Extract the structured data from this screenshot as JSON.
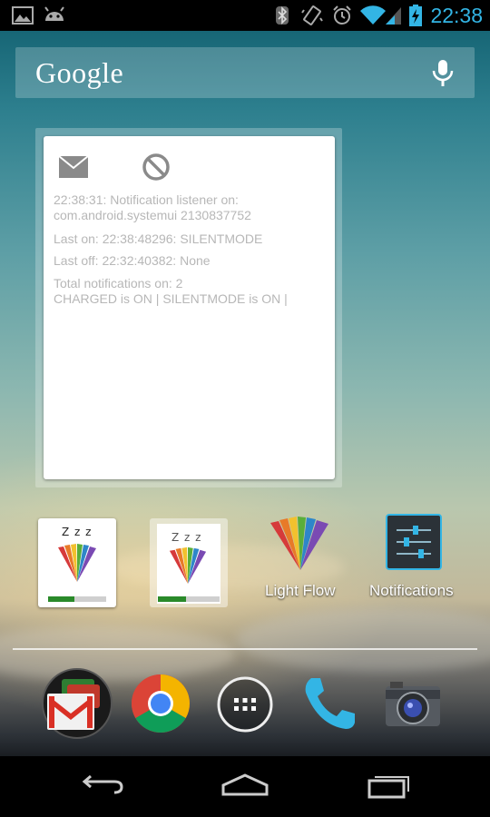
{
  "status_bar": {
    "time": "22:38",
    "left_icons": [
      "gallery-notification-icon",
      "android-debug-icon"
    ],
    "right_icons": [
      "bluetooth-icon",
      "vibrate-icon",
      "alarm-icon",
      "wifi-icon",
      "signal-icon",
      "battery-charging-icon"
    ],
    "accent_color": "#33b5e5"
  },
  "search": {
    "logo": "Google",
    "icon": "microphone-icon"
  },
  "widget": {
    "icons": [
      "mail-icon",
      "do-not-disturb-icon"
    ],
    "listener_line1": "22:38:31: Notification listener on:",
    "listener_line2": "com.android.systemui 2130837752",
    "last_on": "Last on: 22:38:48296: SILENTMODE",
    "last_off": "Last off: 22:32:40382: None",
    "total": "Total notifications on: 2",
    "states": "CHARGED is ON | SILENTMODE is ON |"
  },
  "desktop": {
    "mini_widgets": [
      {
        "zzz": "Z z z",
        "progress": 0.45
      },
      {
        "zzz": "Z z z",
        "progress": 0.45
      }
    ],
    "apps": [
      {
        "label": "Light Flow",
        "icon": "light-flow-icon"
      },
      {
        "label": "Notifications",
        "icon": "notification-settings-icon"
      }
    ]
  },
  "dock": {
    "apps": [
      "gmail-icon",
      "chrome-icon",
      "app-drawer-icon",
      "phone-icon",
      "camera-icon"
    ]
  },
  "nav": {
    "buttons": [
      "back-icon",
      "home-icon",
      "recent-apps-icon"
    ]
  }
}
